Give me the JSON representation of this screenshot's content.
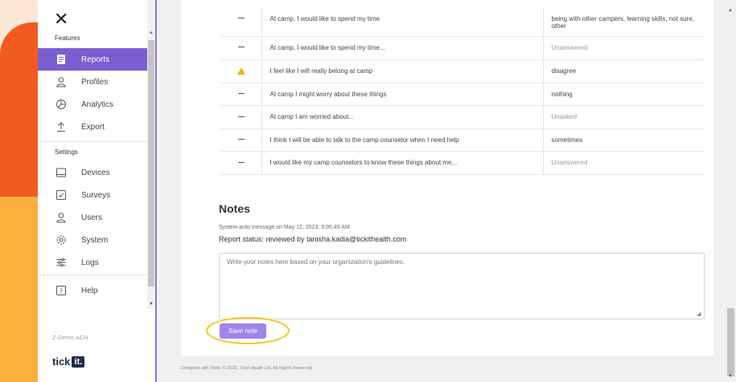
{
  "sidebar": {
    "close_glyph": "✕",
    "features_label": "Features",
    "settings_label": "Settings",
    "features_items": [
      {
        "label": "Reports",
        "icon": "document-icon",
        "active": true
      },
      {
        "label": "Profiles",
        "icon": "user-icon"
      },
      {
        "label": "Analytics",
        "icon": "analytics-icon"
      },
      {
        "label": "Export",
        "icon": "upload-icon"
      }
    ],
    "settings_items": [
      {
        "label": "Devices",
        "icon": "tablet-icon"
      },
      {
        "label": "Surveys",
        "icon": "checkbox-icon"
      },
      {
        "label": "Users",
        "icon": "user-icon"
      },
      {
        "label": "System",
        "icon": "gear-icon"
      },
      {
        "label": "Logs",
        "icon": "sliders-icon"
      }
    ],
    "help_item": {
      "label": "Help",
      "icon": "question-icon"
    },
    "org_name": "Z-Demo ACH",
    "logo_text": "tick",
    "logo_box": "it."
  },
  "questions": [
    {
      "status": "none",
      "question": "At camp, I would like to spend my time",
      "answer": "being with other campers, learning skills, not sure, other",
      "muted": false
    },
    {
      "status": "none",
      "question": "At camp, I would like to spend my time...",
      "answer": "Unanswered",
      "muted": true
    },
    {
      "status": "warning",
      "question": "I feel like I will really belong at camp",
      "answer": "disagree",
      "muted": false
    },
    {
      "status": "none",
      "question": "At camp I might worry about these things",
      "answer": "nothing",
      "muted": false
    },
    {
      "status": "none",
      "question": "At camp I am worried about...",
      "answer": "Unasked",
      "muted": true
    },
    {
      "status": "none",
      "question": "I think I will be able to talk to the camp counselor when I need help",
      "answer": "sometimes",
      "muted": false
    },
    {
      "status": "none",
      "question": "I would like my camp counselors to know these things about me...",
      "answer": "Unanswered",
      "muted": true
    }
  ],
  "notes": {
    "title": "Notes",
    "system_message": "System auto message on May 12, 2023, 9:05:49 AM",
    "report_status": "Report status: reviewed by tanisha.kadia@tickithealth.com",
    "placeholder": "Write your notes here based on your organization's guidelines.",
    "value": "",
    "save_label": "Save note"
  },
  "footer": {
    "text": "Designed with Tickit. © 2023, Tickit Health Ltd. All Rights Reserved."
  },
  "colors": {
    "accent": "#7b5fd0",
    "button": "#a084e8",
    "warning": "#f0b400",
    "highlight": "#f5c518"
  }
}
